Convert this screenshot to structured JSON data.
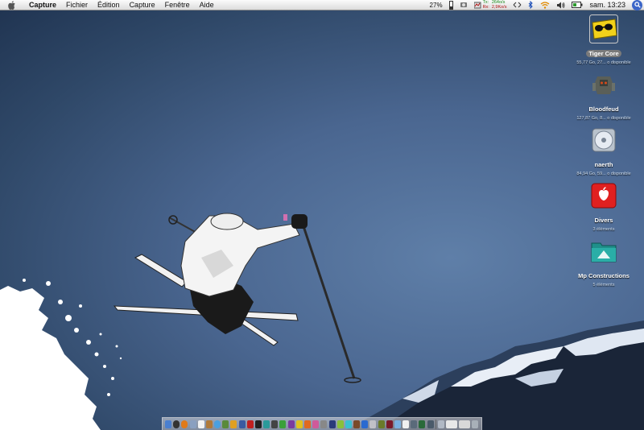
{
  "menubar": {
    "app_name": "Capture",
    "items": [
      "Fichier",
      "Édition",
      "Capture",
      "Fenêtre",
      "Aide"
    ],
    "battery_percent": "27%",
    "network": {
      "tx_label": "Tx:",
      "tx_value": "264o/s",
      "rx_label": "Rx:",
      "rx_value": "2,9Ko/s"
    },
    "clock": "sam. 13:23"
  },
  "desktop_icons": [
    {
      "name": "Tiger Core",
      "info": "55,77 Go, 27... o disponible",
      "icon": "drive-sunglasses-icon"
    },
    {
      "name": "Bloodfeud",
      "info": "127,87 Go, 8... o disponible",
      "icon": "drive-robot-icon"
    },
    {
      "name": "naerth",
      "info": "84,94 Go, 59... o disponible",
      "icon": "drive-disc-icon"
    },
    {
      "name": "Divers",
      "info": "3 éléments",
      "icon": "red-folder-icon"
    },
    {
      "name": "Mp Constructions",
      "info": "5 éléments",
      "icon": "teal-folder-icon"
    }
  ],
  "colors": {
    "tx": "#1a8a1a",
    "rx": "#b01010",
    "desktop": "#4a6690"
  }
}
